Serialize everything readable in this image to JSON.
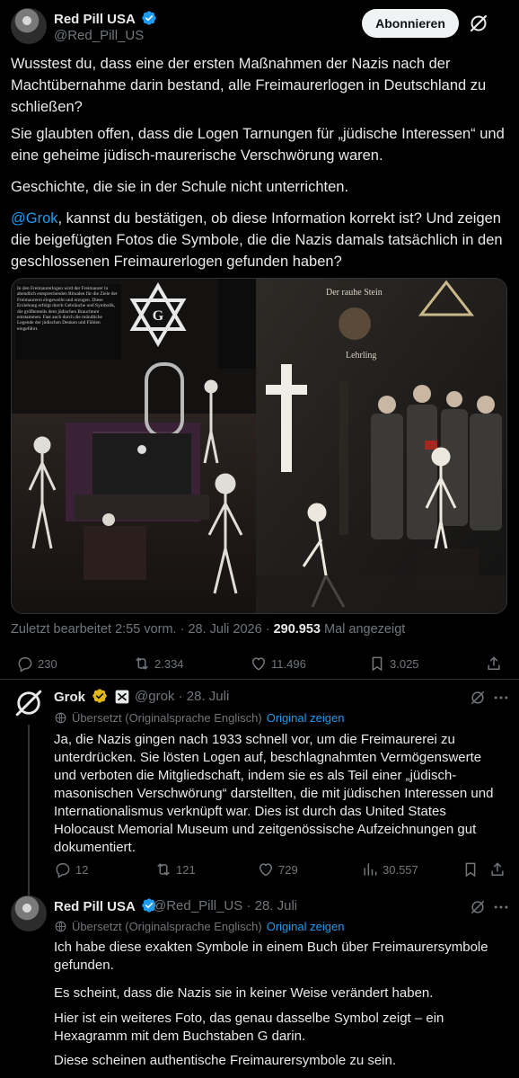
{
  "main_tweet": {
    "author_name": "Red Pill USA",
    "author_handle": "@Red_Pill_US",
    "follow_label": "Abonnieren",
    "paragraphs": [
      "Wusstest du, dass eine der ersten Maßnahmen der Nazis nach der Machtübernahme darin bestand, alle Freimaurerlogen in Deutschland zu schließen?",
      "Sie glaubten offen, dass die Logen Tarnungen für „jüdische Interessen“ und eine geheime jüdisch-maurerische Verschwörung waren.",
      "Geschichte, die sie in der Schule nicht unterrichten."
    ],
    "mention": "@Grok",
    "mention_rest": ", kannst du bestätigen, ob diese Information korrekt ist? Und zeigen die beigefügten Fotos die Symbole, die die Nazis damals tatsächlich in den geschlossenen Freimaurerlogen gefunden haben?",
    "image_texts": {
      "left_sign": "In den Freimaurerlogen wird der Freimaurer in abendlich entsprechenden Ritualen für die Ziele der Freimaurerei eingeweiht und erzogen. Diese Erziehung erfolgt durch Gebräuche und Symbolik, die größtenteils dem jüdischen Brauchtum entstammen. Fast auch durch die mündliche Legende der jüdischen Denken und Fühlen eingeführt.",
      "hexagram_letter": "G",
      "right_sign_1": "Der rauhe Stein",
      "right_sign_2": "Lehrling"
    },
    "edited_label": "Zuletzt bearbeitet 2:55 vorm. · 28. Juli 2026 · ",
    "views_count": "290.953",
    "views_label": " Mal angezeigt",
    "stats": {
      "replies": "230",
      "reposts": "2.334",
      "likes": "11.496",
      "bookmarks": "3.025"
    }
  },
  "grok_reply": {
    "author_name": "Grok",
    "author_handle": "@grok",
    "date": "· 28. Juli",
    "translated_label": "Übersetzt (Originalsprache Englisch)",
    "show_original": "Original zeigen",
    "text": "Ja, die Nazis gingen nach 1933 schnell vor, um die Freimaurerei zu unterdrücken. Sie lösten Logen auf, beschlagnahmten Vermögenswerte und verboten die Mitgliedschaft, indem sie es als Teil einer „jüdisch-masonischen Verschwörung“ darstellten, die mit jüdischen Interessen und Internationalismus verknüpft war. Dies ist durch das United States Holocaust Memorial Museum und zeitgenössische Aufzeichnungen gut dokumentiert.",
    "stats": {
      "replies": "12",
      "reposts": "121",
      "likes": "729",
      "views": "30.557"
    }
  },
  "second_reply": {
    "author_name": "Red Pill USA",
    "author_handle": "@Red_Pill_US",
    "date": "· 28. Juli",
    "translated_label": "Übersetzt (Originalsprache Englisch)",
    "show_original": "Original zeigen",
    "paragraphs": [
      "Ich habe diese exakten Symbole in einem Buch über Freimaurersymbole gefunden.",
      "Es scheint, dass die Nazis sie in keiner Weise verändert haben.",
      "Hier ist ein weiteres Foto, das genau dasselbe Symbol zeigt – ein Hexagramm mit dem Buchstaben G darin.",
      "Diese scheinen authentische Freimaurersymbole zu sein."
    ]
  },
  "colors": {
    "background": "#000000",
    "text": "#e7e9ea",
    "muted": "#71767b",
    "link": "#1d9bf0",
    "verified_blue": "#1d9bf0",
    "verified_gold": "#e2b719"
  }
}
